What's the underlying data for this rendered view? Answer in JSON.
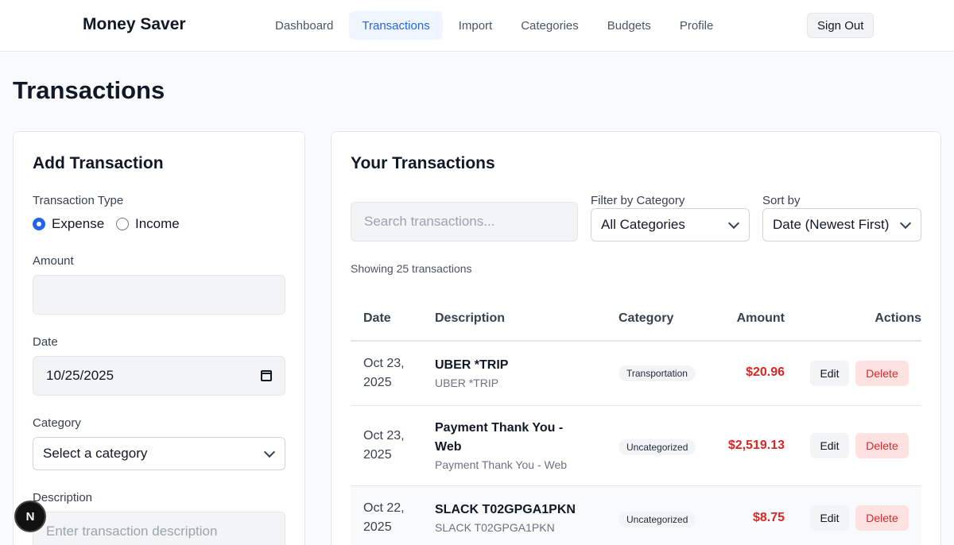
{
  "app": {
    "brand": "Money Saver"
  },
  "nav": {
    "items": [
      {
        "label": "Dashboard"
      },
      {
        "label": "Transactions",
        "active": true
      },
      {
        "label": "Import"
      },
      {
        "label": "Categories"
      },
      {
        "label": "Budgets"
      },
      {
        "label": "Profile"
      }
    ],
    "sign_out": "Sign Out"
  },
  "page": {
    "title": "Transactions"
  },
  "add_form": {
    "title": "Add Transaction",
    "type_label": "Transaction Type",
    "type_expense": "Expense",
    "type_income": "Income",
    "selected_type": "Expense",
    "amount_label": "Amount",
    "amount_value": "",
    "date_label": "Date",
    "date_value": "10/25/2025",
    "category_label": "Category",
    "category_value": "Select a category",
    "description_label": "Description",
    "description_placeholder": "Enter transaction description"
  },
  "list": {
    "title": "Your Transactions",
    "search_placeholder": "Search transactions...",
    "filter_label": "Filter by Category",
    "filter_value": "All Categories",
    "sort_label": "Sort by",
    "sort_value": "Date (Newest First)",
    "showing": "Showing 25 transactions",
    "columns": {
      "date": "Date",
      "description": "Description",
      "category": "Category",
      "amount": "Amount",
      "actions": "Actions"
    },
    "edit_label": "Edit",
    "delete_label": "Delete",
    "rows": [
      {
        "date_line1": "Oct 23,",
        "date_line2": "2025",
        "title": "UBER *TRIP",
        "subtitle": "UBER *TRIP",
        "category": "Transportation",
        "amount": "$20.96"
      },
      {
        "date_line1": "Oct 23,",
        "date_line2": "2025",
        "title_line1": "Payment Thank You -",
        "title_line2": "Web",
        "subtitle": "Payment Thank You - Web",
        "category": "Uncategorized",
        "amount": "$2,519.13"
      },
      {
        "date_line1": "Oct 22,",
        "date_line2": "2025",
        "title": "SLACK T02GPGA1PKN",
        "subtitle": "SLACK T02GPGA1PKN",
        "category": "Uncategorized",
        "amount": "$8.75"
      }
    ]
  },
  "dev_badge": {
    "letter": "N"
  },
  "colors": {
    "accent": "#2563eb",
    "expense": "#dc2626",
    "delete_bg": "#fee2e2"
  }
}
